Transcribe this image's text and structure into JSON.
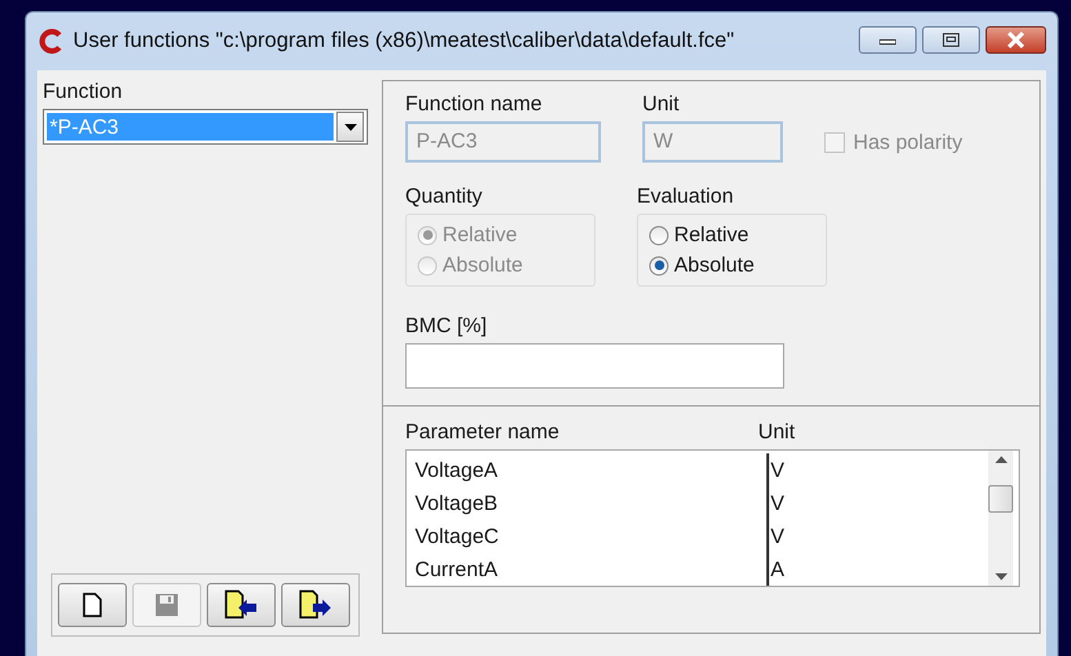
{
  "window": {
    "title": "User functions \"c:\\program files (x86)\\meatest\\caliber\\data\\default.fce\""
  },
  "function_select": {
    "label": "Function",
    "value": "*P-AC3",
    "highlighted": true
  },
  "toolbar": [
    {
      "kind": "new",
      "disabled": false
    },
    {
      "kind": "save",
      "disabled": true
    },
    {
      "kind": "import",
      "disabled": false
    },
    {
      "kind": "export",
      "disabled": false
    }
  ],
  "function_name": {
    "label": "Function name",
    "value": "P-AC3",
    "disabled": true
  },
  "unit": {
    "label": "Unit",
    "value": "W",
    "disabled": true
  },
  "has_polarity": {
    "label": "Has polarity",
    "checked": false,
    "disabled": true
  },
  "quantity": {
    "label": "Quantity",
    "disabled": true,
    "options": [
      {
        "label": "Relative",
        "selected": true
      },
      {
        "label": "Absolute",
        "selected": false
      }
    ]
  },
  "evaluation": {
    "label": "Evaluation",
    "disabled": false,
    "options": [
      {
        "label": "Relative",
        "selected": false
      },
      {
        "label": "Absolute",
        "selected": true
      }
    ]
  },
  "bmc": {
    "label": "BMC [%]"
  },
  "parameters": {
    "columns": [
      "Parameter name",
      "Unit"
    ],
    "rows": [
      {
        "name": "VoltageA",
        "unit": "V"
      },
      {
        "name": "VoltageB",
        "unit": "V"
      },
      {
        "name": "VoltageC",
        "unit": "V"
      },
      {
        "name": "CurrentA",
        "unit": "A"
      }
    ]
  }
}
